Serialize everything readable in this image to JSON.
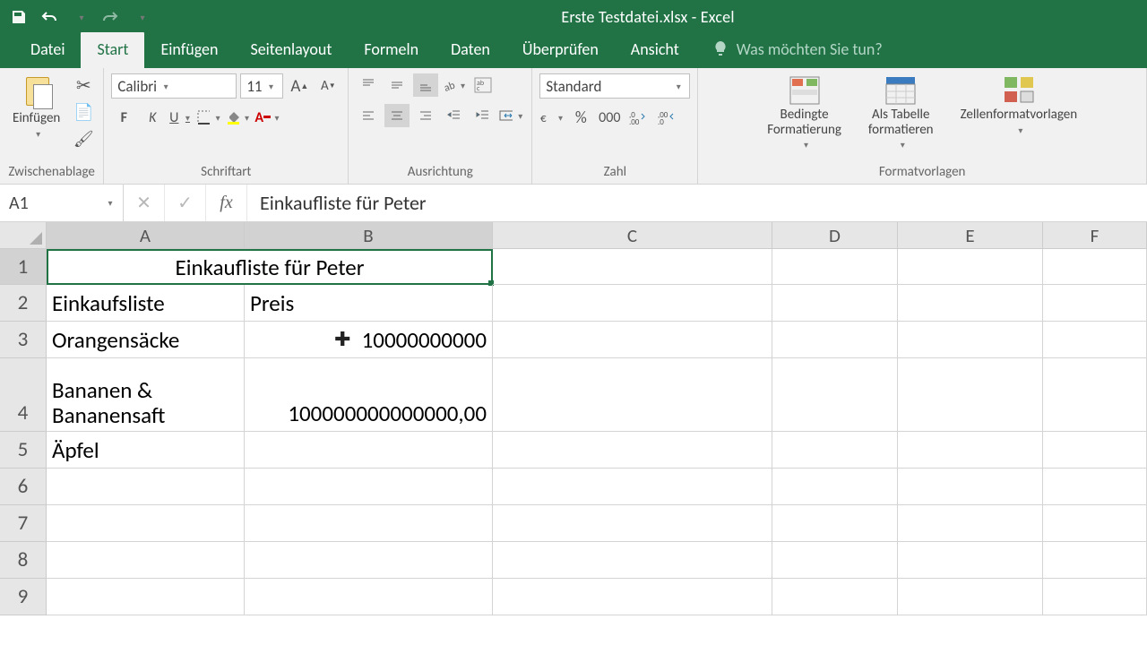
{
  "app": {
    "title": "Erste Testdatei.xlsx - Excel"
  },
  "tabs": [
    "Datei",
    "Start",
    "Einfügen",
    "Seitenlayout",
    "Formeln",
    "Daten",
    "Überprüfen",
    "Ansicht"
  ],
  "active_tab": "Start",
  "tellme_placeholder": "Was möchten Sie tun?",
  "ribbon": {
    "clipboard": {
      "paste": "Einfügen",
      "label": "Zwischenablage"
    },
    "font": {
      "name": "Calibri",
      "size": "11",
      "bold": "F",
      "italic": "K",
      "underline": "U",
      "label": "Schriftart"
    },
    "alignment": {
      "label": "Ausrichtung"
    },
    "number": {
      "format": "Standard",
      "label": "Zahl"
    },
    "styles": {
      "cond": "Bedingte\nFormatierung",
      "table": "Als Tabelle\nformatieren",
      "cell": "Zellenformatvorlagen",
      "label": "Formatvorlagen"
    }
  },
  "namebox": "A1",
  "formula": "Einkaufliste für Peter",
  "columns": [
    "A",
    "B",
    "C",
    "D",
    "E",
    "F"
  ],
  "rows": [
    "1",
    "2",
    "3",
    "4",
    "5",
    "6",
    "7",
    "8",
    "9"
  ],
  "cells": {
    "A1": "Einkaufliste für Peter",
    "A2": "Einkaufsliste",
    "B2": "Preis",
    "A3": "Orangensäcke",
    "B3": "10000000000",
    "A4": "Bananen &\nBananensaft",
    "B4": "100000000000000,00",
    "A5": "Äpfel"
  }
}
